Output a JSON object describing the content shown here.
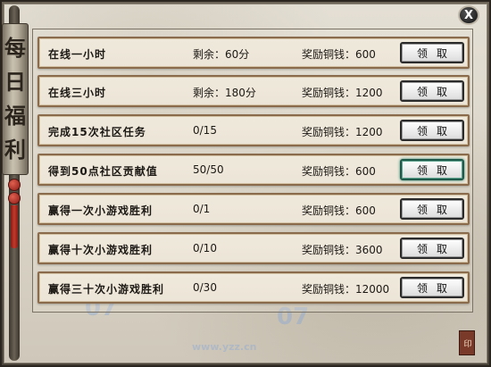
{
  "window": {
    "title_chars": [
      "每",
      "日",
      "福",
      "利"
    ],
    "close_label": "X",
    "seal_text": "印"
  },
  "tasks": [
    {
      "title": "在线一小时",
      "progress": "剩余：60分",
      "reward": "奖励铜钱：600",
      "button": "领取",
      "active": false
    },
    {
      "title": "在线三小时",
      "progress": "剩余：180分",
      "reward": "奖励铜钱：1200",
      "button": "领取",
      "active": false
    },
    {
      "title": "完成15次社区任务",
      "progress": "0/15",
      "reward": "奖励铜钱：1200",
      "button": "领取",
      "active": false
    },
    {
      "title": "得到50点社区贡献值",
      "progress": "50/50",
      "reward": "奖励铜钱：600",
      "button": "领取",
      "active": true
    },
    {
      "title": "赢得一次小游戏胜利",
      "progress": "0/1",
      "reward": "奖励铜钱：600",
      "button": "领取",
      "active": false
    },
    {
      "title": "赢得十次小游戏胜利",
      "progress": "0/10",
      "reward": "奖励铜钱：3600",
      "button": "领取",
      "active": false
    },
    {
      "title": "赢得三十次小游戏胜利",
      "progress": "0/30",
      "reward": "奖励铜钱：12000",
      "button": "领取",
      "active": false
    }
  ],
  "watermark": "www.yzz.cn",
  "colors": {
    "row_border": "#8a6b4c",
    "button_border": "#2b2b2b",
    "active_button_border": "#1f5a4a",
    "tassel": "#c23a2c"
  }
}
